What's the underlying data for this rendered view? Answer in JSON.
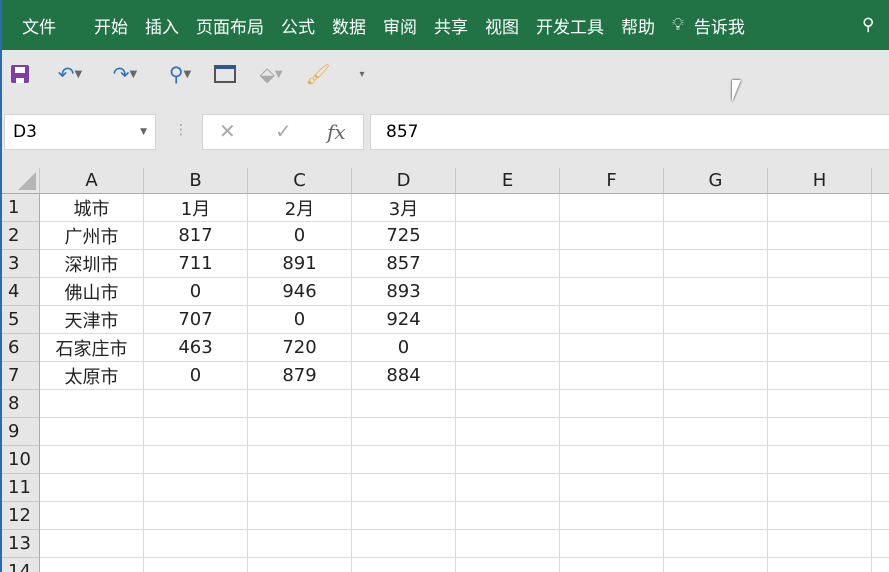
{
  "ribbon": {
    "tabs": [
      "文件",
      "开始",
      "插入",
      "页面布局",
      "公式",
      "数据",
      "审阅",
      "共享",
      "视图",
      "开发工具",
      "帮助"
    ],
    "tell_me": "告诉我"
  },
  "formula_bar": {
    "name_box": "D3",
    "value": "857",
    "fx": "fx"
  },
  "columns": [
    "A",
    "B",
    "C",
    "D",
    "E",
    "F",
    "G",
    "H"
  ],
  "rows": [
    [
      "城市",
      "1月",
      "2月",
      "3月"
    ],
    [
      "广州市",
      "817",
      "0",
      "725"
    ],
    [
      "深圳市",
      "711",
      "891",
      "857"
    ],
    [
      "佛山市",
      "0",
      "946",
      "893"
    ],
    [
      "天津市",
      "707",
      "0",
      "924"
    ],
    [
      "石家庄市",
      "463",
      "720",
      "0"
    ],
    [
      "太原市",
      "0",
      "879",
      "884"
    ],
    [],
    [],
    [],
    [],
    [],
    [],
    []
  ],
  "row_numbers": [
    "1",
    "2",
    "3",
    "4",
    "5",
    "6",
    "7",
    "8",
    "9",
    "10",
    "11",
    "12",
    "13",
    "14"
  ],
  "colors": {
    "ribbon": "#217346"
  }
}
